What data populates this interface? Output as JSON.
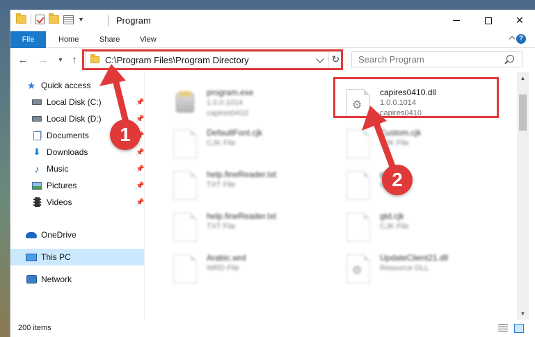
{
  "window": {
    "title": "Program"
  },
  "ribbon": {
    "tabs": [
      "File",
      "Home",
      "Share",
      "View"
    ]
  },
  "navigation": {
    "address": "C:\\Program Files\\Program Directory",
    "search_placeholder": "Search Program"
  },
  "sidebar": {
    "items": [
      {
        "label": "Quick access",
        "icon": "star-icon",
        "pinned": false
      },
      {
        "label": "Local Disk (C:)",
        "icon": "drive-icon",
        "pinned": true
      },
      {
        "label": "Local Disk (D:)",
        "icon": "drive-icon",
        "pinned": true
      },
      {
        "label": "Documents",
        "icon": "documents-icon",
        "pinned": true
      },
      {
        "label": "Downloads",
        "icon": "downloads-icon",
        "pinned": true
      },
      {
        "label": "Music",
        "icon": "music-icon",
        "pinned": true
      },
      {
        "label": "Pictures",
        "icon": "pictures-icon",
        "pinned": true
      },
      {
        "label": "Videos",
        "icon": "videos-icon",
        "pinned": true
      },
      {
        "label": "OneDrive",
        "icon": "cloud-icon",
        "pinned": false
      },
      {
        "label": "This PC",
        "icon": "computer-icon",
        "pinned": false,
        "selected": true
      },
      {
        "label": "Network",
        "icon": "network-icon",
        "pinned": false
      }
    ]
  },
  "files": [
    {
      "name": "program.exe",
      "sub1": "1.0.0.1014",
      "sub2": "capires0410",
      "icon": "exe-icon",
      "blurred": true
    },
    {
      "name": "capires0410.dll",
      "sub1": "1.0.0.1014",
      "sub2": "capires0410",
      "icon": "dll-icon",
      "blurred": false,
      "highlighted": true
    },
    {
      "name": "DefaultFont.cjk",
      "sub1": "CJK File",
      "sub2": "",
      "icon": "file-icon",
      "blurred": true
    },
    {
      "name": "Custom.cjk",
      "sub1": "CJK File",
      "sub2": "",
      "icon": "file-icon",
      "blurred": true
    },
    {
      "name": "help.fineReader.txt",
      "sub1": "TXT File",
      "sub2": "",
      "icon": "file-icon",
      "blurred": true
    },
    {
      "name": "gtd.cjk",
      "sub1": "CJK File",
      "sub2": "",
      "icon": "file-icon",
      "blurred": true
    },
    {
      "name": "help.fineReader.txt",
      "sub1": "TXT File",
      "sub2": "",
      "icon": "file-icon",
      "blurred": true
    },
    {
      "name": "gtd.cjk",
      "sub1": "CJK File",
      "sub2": "",
      "icon": "file-icon",
      "blurred": true
    },
    {
      "name": "Arabic.wrd",
      "sub1": "WRD File",
      "sub2": "",
      "icon": "file-icon",
      "blurred": true
    },
    {
      "name": "UpdateClient21.dll",
      "sub1": "Resource DLL",
      "sub2": "",
      "icon": "dll-icon",
      "blurred": true
    }
  ],
  "status": {
    "item_count": "200 items"
  },
  "annotations": {
    "step1": "1",
    "step2": "2",
    "color": "#e0393a"
  },
  "colors": {
    "accent": "#1979ca",
    "selection": "#cce8ff"
  }
}
